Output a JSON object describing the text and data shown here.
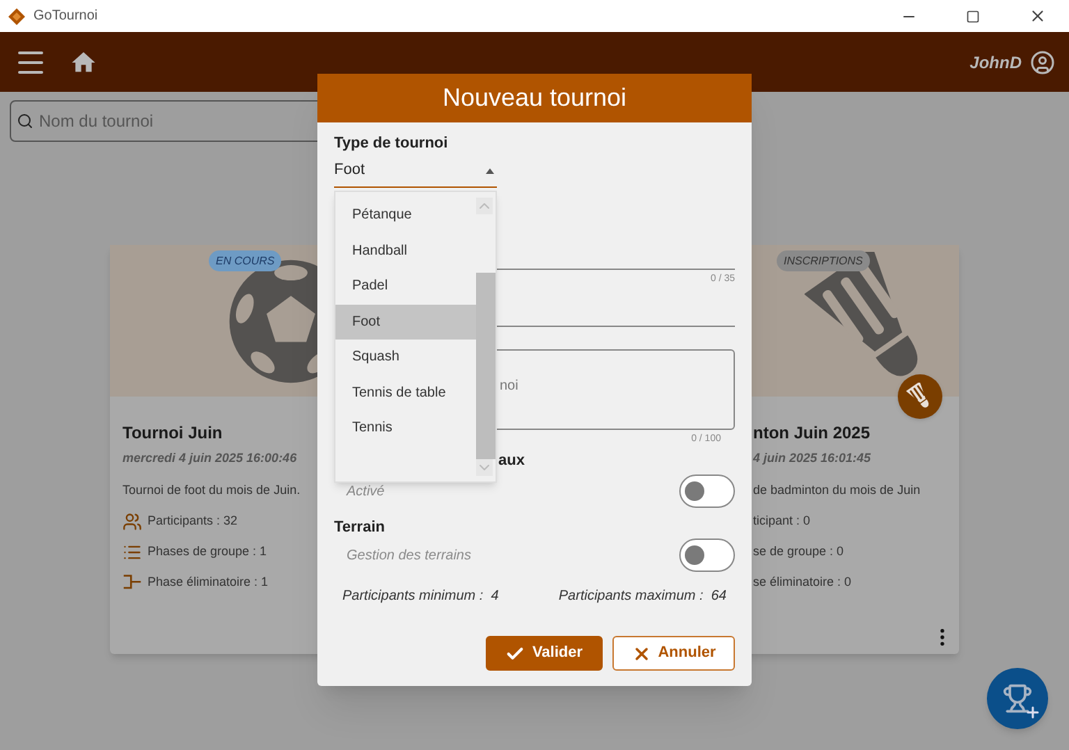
{
  "window": {
    "title": "GoTournoi"
  },
  "app_bar": {
    "user": "JohnD"
  },
  "search": {
    "placeholder": "Nom du tournoi"
  },
  "cards": [
    {
      "kind": "football",
      "status": {
        "label": "EN COURS",
        "color": "#6e9bc4"
      },
      "title": "Tournoi Juin",
      "date": "mercredi 4 juin 2025 16:00:46",
      "description": "Tournoi de foot du mois de Juin.",
      "stats": [
        {
          "kind": "participants",
          "text": "Participants : 32"
        },
        {
          "kind": "groups",
          "text": "Phases de groupe : 1"
        },
        {
          "kind": "knockout",
          "text": "Phase éliminatoire : 1"
        }
      ]
    },
    {
      "kind": "badminton",
      "status": {
        "label": "INSCRIPTIONS",
        "color": "#8a8a8a"
      },
      "title": "nton Juin 2025",
      "date": "4 juin 2025 16:01:45",
      "description": "de badminton du mois de Juin",
      "stats": [
        {
          "kind": "text",
          "text": "ticipant : 0"
        },
        {
          "kind": "text",
          "text": "se de groupe : 0"
        },
        {
          "kind": "text",
          "text": "se éliminatoire : 0"
        }
      ]
    }
  ],
  "dialog": {
    "title": "Nouveau tournoi",
    "type_label": "Type de tournoi",
    "type_value": "Foot",
    "options": [
      {
        "label": "Pétanque",
        "selected": false
      },
      {
        "label": "Handball",
        "selected": false
      },
      {
        "label": "Padel",
        "selected": false
      },
      {
        "label": "Foot",
        "selected": true
      },
      {
        "label": "Squash",
        "selected": false
      },
      {
        "label": "Tennis de table",
        "selected": false
      },
      {
        "label": "Tennis",
        "selected": false
      }
    ],
    "name_counter": "0 / 35",
    "description_placeholder": "noi",
    "description_counter": "0 / 100",
    "section_1_heading": "aux",
    "toggle_1": {
      "label": "Activé",
      "on": false
    },
    "section_2_heading": "Terrain",
    "toggle_2": {
      "label": "Gestion des terrains",
      "on": false
    },
    "min_participants": "Participants minimum :  4",
    "max_participants": "Participants maximum :  64",
    "buttons": [
      {
        "kind": "primary",
        "label": "Valider"
      },
      {
        "kind": "secondary",
        "label": "Annuler"
      }
    ]
  }
}
